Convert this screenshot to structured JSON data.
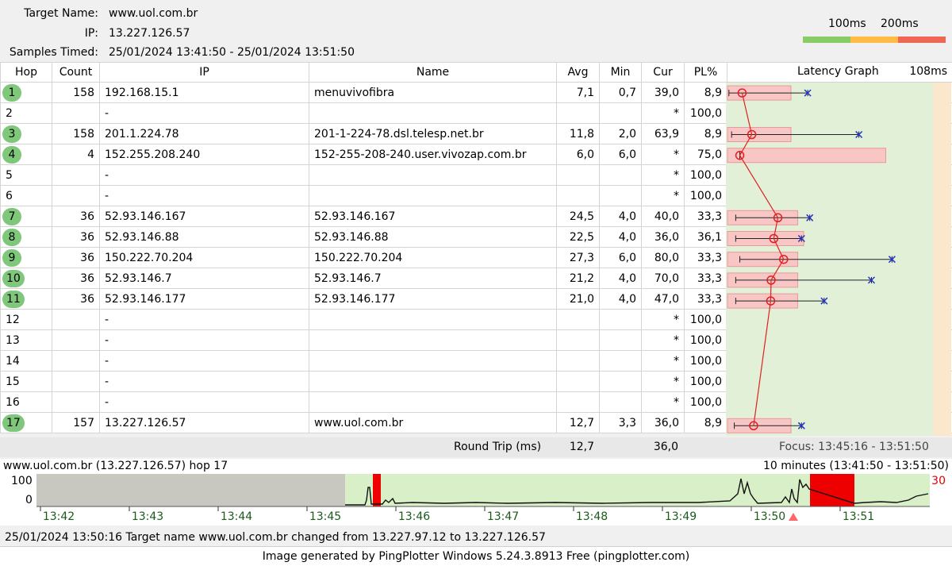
{
  "header": {
    "target_name_label": "Target Name:",
    "target_name": "www.uol.com.br",
    "ip_label": "IP:",
    "ip": "13.227.126.57",
    "samples_label": "Samples Timed:",
    "samples": "25/01/2024 13:41:50 - 25/01/2024 13:51:50",
    "scale_100": "100ms",
    "scale_200": "200ms",
    "scale_colors": [
      "#88cc66",
      "#ffbb44",
      "#ee6655"
    ]
  },
  "columns": {
    "hop": "Hop",
    "count": "Count",
    "ip": "IP",
    "name": "Name",
    "avg": "Avg",
    "min": "Min",
    "cur": "Cur",
    "pl": "PL%",
    "graph": "Latency Graph",
    "graph_max": "108ms"
  },
  "hops": [
    {
      "hop": "1",
      "count": "158",
      "ip": "192.168.15.1",
      "name": "menuvivofibra",
      "avg": "7,1",
      "min": "0,7",
      "cur": "39,0",
      "pl": "8,9",
      "badge": true
    },
    {
      "hop": "2",
      "count": "",
      "ip": "-",
      "name": "",
      "avg": "",
      "min": "",
      "cur": "*",
      "pl": "100,0",
      "badge": false
    },
    {
      "hop": "3",
      "count": "158",
      "ip": "201.1.224.78",
      "name": "201-1-224-78.dsl.telesp.net.br",
      "avg": "11,8",
      "min": "2,0",
      "cur": "63,9",
      "pl": "8,9",
      "badge": true
    },
    {
      "hop": "4",
      "count": "4",
      "ip": "152.255.208.240",
      "name": "152-255-208-240.user.vivozap.com.br",
      "avg": "6,0",
      "min": "6,0",
      "cur": "*",
      "pl": "75,0",
      "badge": true
    },
    {
      "hop": "5",
      "count": "",
      "ip": "-",
      "name": "",
      "avg": "",
      "min": "",
      "cur": "*",
      "pl": "100,0",
      "badge": false
    },
    {
      "hop": "6",
      "count": "",
      "ip": "-",
      "name": "",
      "avg": "",
      "min": "",
      "cur": "*",
      "pl": "100,0",
      "badge": false
    },
    {
      "hop": "7",
      "count": "36",
      "ip": "52.93.146.167",
      "name": "52.93.146.167",
      "avg": "24,5",
      "min": "4,0",
      "cur": "40,0",
      "pl": "33,3",
      "badge": true
    },
    {
      "hop": "8",
      "count": "36",
      "ip": "52.93.146.88",
      "name": "52.93.146.88",
      "avg": "22,5",
      "min": "4,0",
      "cur": "36,0",
      "pl": "36,1",
      "badge": true
    },
    {
      "hop": "9",
      "count": "36",
      "ip": "150.222.70.204",
      "name": "150.222.70.204",
      "avg": "27,3",
      "min": "6,0",
      "cur": "80,0",
      "pl": "33,3",
      "badge": true
    },
    {
      "hop": "10",
      "count": "36",
      "ip": "52.93.146.7",
      "name": "52.93.146.7",
      "avg": "21,2",
      "min": "4,0",
      "cur": "70,0",
      "pl": "33,3",
      "badge": true
    },
    {
      "hop": "11",
      "count": "36",
      "ip": "52.93.146.177",
      "name": "52.93.146.177",
      "avg": "21,0",
      "min": "4,0",
      "cur": "47,0",
      "pl": "33,3",
      "badge": true
    },
    {
      "hop": "12",
      "count": "",
      "ip": "-",
      "name": "",
      "avg": "",
      "min": "",
      "cur": "*",
      "pl": "100,0",
      "badge": false
    },
    {
      "hop": "13",
      "count": "",
      "ip": "-",
      "name": "",
      "avg": "",
      "min": "",
      "cur": "*",
      "pl": "100,0",
      "badge": false
    },
    {
      "hop": "14",
      "count": "",
      "ip": "-",
      "name": "",
      "avg": "",
      "min": "",
      "cur": "*",
      "pl": "100,0",
      "badge": false
    },
    {
      "hop": "15",
      "count": "",
      "ip": "-",
      "name": "",
      "avg": "",
      "min": "",
      "cur": "*",
      "pl": "100,0",
      "badge": false
    },
    {
      "hop": "16",
      "count": "",
      "ip": "-",
      "name": "",
      "avg": "",
      "min": "",
      "cur": "*",
      "pl": "100,0",
      "badge": false
    },
    {
      "hop": "17",
      "count": "157",
      "ip": "13.227.126.57",
      "name": "www.uol.com.br",
      "avg": "12,7",
      "min": "3,3",
      "cur": "36,0",
      "pl": "8,9",
      "badge": true
    }
  ],
  "round_trip": {
    "label": "Round Trip (ms)",
    "avg": "12,7",
    "cur": "36,0",
    "focus": "Focus: 13:45:16 - 13:51:50"
  },
  "history": {
    "title": "www.uol.com.br (13.227.126.57) hop 17",
    "range": "10 minutes (13:41:50 - 13:51:50)",
    "y_max": "100",
    "y_min": "0",
    "right_value": "30",
    "times": [
      "13:42",
      "13:43",
      "13:44",
      "13:45",
      "13:46",
      "13:47",
      "13:48",
      "13:49",
      "13:50",
      "13:51"
    ]
  },
  "status": "25/01/2024 13:50:16 Target name www.uol.com.br changed from 13.227.97.12 to 13.227.126.57",
  "footer": "Image generated by PingPlotter Windows 5.24.3.8913 Free (pingplotter.com)"
}
